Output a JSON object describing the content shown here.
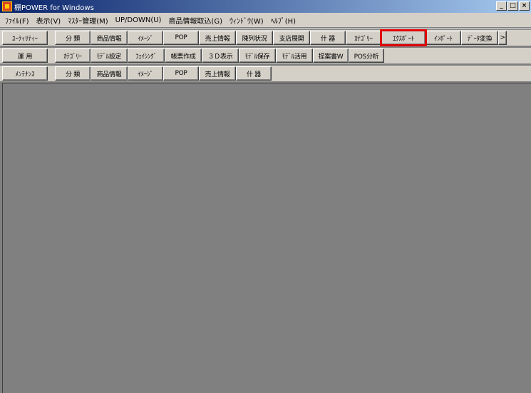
{
  "window": {
    "title": "棚POWER for Windows",
    "minimize": "_",
    "maximize": "□",
    "close": "×"
  },
  "menu": [
    "ﾌｧｲﾙ(F)",
    "表示(V)",
    "ﾏｽﾀｰ管理(M)",
    "UP/DOWN(U)",
    "商品情報取込(G)",
    "ｳｨﾝﾄﾞｳ(W)",
    "ﾍﾙﾌﾟ(H)"
  ],
  "toolbar": {
    "row1": {
      "category": "ﾕｰﾃｨﾘﾃｨｰ",
      "buttons": [
        "分 類",
        "商品情報",
        "ｲﾒｰｼﾞ",
        "POP",
        "売上情報",
        "陳列状況",
        "支店展開",
        "什 器",
        "ｶﾃｺﾞﾘｰ",
        "ｴｸｽﾎﾟｰﾄ",
        "ｲﾝﾎﾟｰﾄ",
        "ﾃﾞｰﾀ変換",
        ">"
      ]
    },
    "row2": {
      "category": "運 用",
      "buttons": [
        "ｶﾃｺﾞﾘｰ",
        "ﾓﾃﾞﾙ設定",
        "ﾌｪｲｼﾝｸﾞ",
        "帳票作成",
        "３Ｄ表示",
        "ﾓﾃﾞﾙ保存",
        "ﾓﾃﾞﾙ活用",
        "提案書W",
        "POS分析"
      ]
    },
    "row3": {
      "category": "ﾒﾝﾃﾅﾝｽ",
      "buttons": [
        "分 類",
        "商品情報",
        "ｲﾒｰｼﾞ",
        "POP",
        "売上情報",
        "什 器"
      ]
    }
  },
  "highlight": {
    "color": "#e00000",
    "target": "ｴｸｽﾎﾟｰﾄ"
  }
}
